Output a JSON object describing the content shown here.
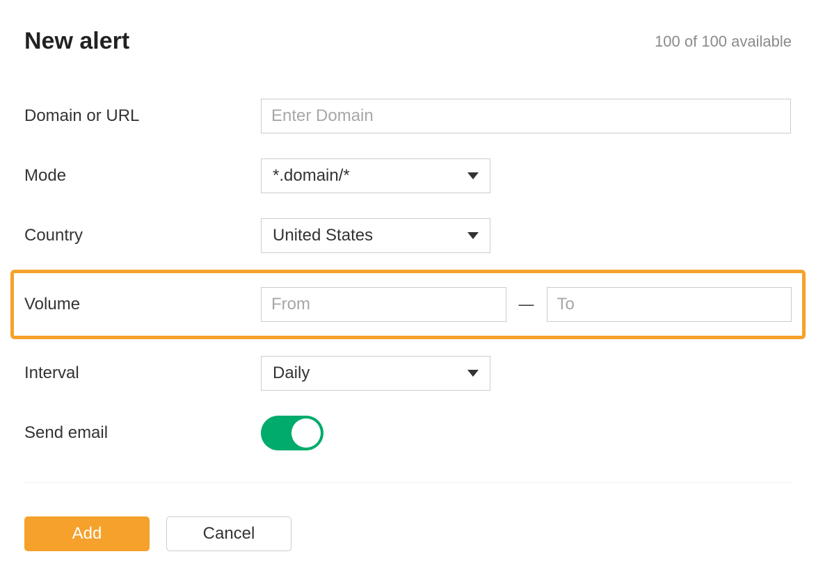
{
  "header": {
    "title": "New alert",
    "availability": "100 of 100 available"
  },
  "form": {
    "domain": {
      "label": "Domain or URL",
      "placeholder": "Enter Domain",
      "value": ""
    },
    "mode": {
      "label": "Mode",
      "selected": "*.domain/*"
    },
    "country": {
      "label": "Country",
      "selected": "United States"
    },
    "volume": {
      "label": "Volume",
      "from_placeholder": "From",
      "from_value": "",
      "to_placeholder": "To",
      "to_value": "",
      "separator": "—"
    },
    "interval": {
      "label": "Interval",
      "selected": "Daily"
    },
    "send_email": {
      "label": "Send email",
      "enabled": true
    }
  },
  "actions": {
    "add": "Add",
    "cancel": "Cancel"
  },
  "colors": {
    "accent_orange": "#f5a12b",
    "toggle_green": "#00ab6b"
  }
}
